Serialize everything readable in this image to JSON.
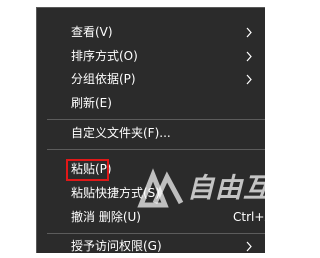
{
  "context_menu": {
    "items": [
      {
        "label": "查看(V)",
        "has_submenu": true
      },
      {
        "label": "排序方式(O)",
        "has_submenu": true
      },
      {
        "label": "分组依据(P)",
        "has_submenu": true
      },
      {
        "label": "刷新(E)",
        "has_submenu": false
      },
      {
        "label": "自定义文件夹(F)...",
        "has_submenu": false
      },
      {
        "label": "粘贴(P)",
        "has_submenu": false,
        "highlighted": true
      },
      {
        "label": "粘贴快捷方式(S)",
        "has_submenu": false
      },
      {
        "label": "撤消 删除(U)",
        "shortcut": "Ctrl+Z",
        "has_submenu": false
      },
      {
        "label": "授予访问权限(G)",
        "has_submenu": true
      }
    ],
    "background_color": "#2b2b2b",
    "text_color": "#ffffff",
    "highlight_color": "#e01818"
  },
  "watermark": {
    "text": "自由互联",
    "icon": "watermark-logo-icon"
  }
}
